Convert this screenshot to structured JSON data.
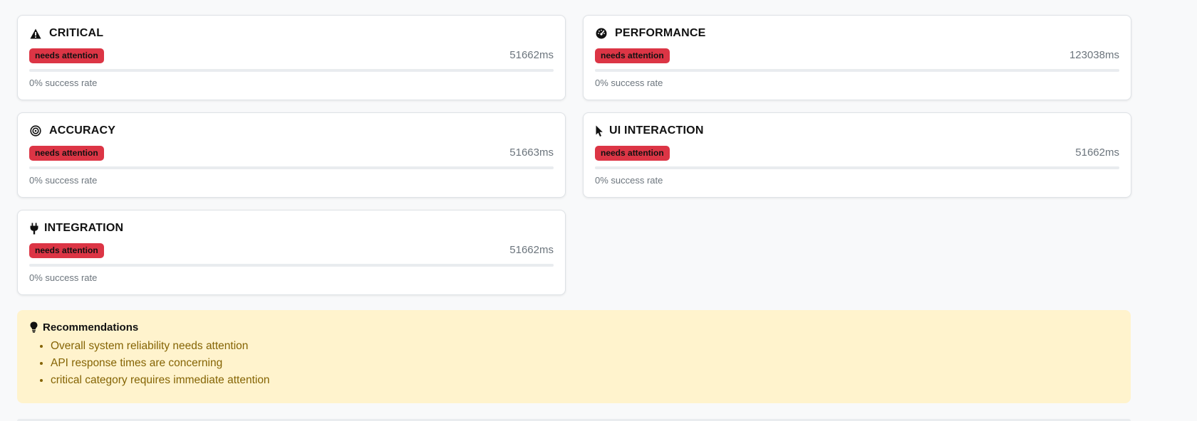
{
  "cards": [
    {
      "title": "CRITICAL",
      "icon": "warning-icon",
      "badge": "needs attention",
      "time": "51662ms",
      "success_fraction": 0,
      "rate": "0% success rate"
    },
    {
      "title": "PERFORMANCE",
      "icon": "gauge-icon",
      "badge": "needs attention",
      "time": "123038ms",
      "success_fraction": 0,
      "rate": "0% success rate"
    },
    {
      "title": "ACCURACY",
      "icon": "target-icon",
      "badge": "needs attention",
      "time": "51663ms",
      "success_fraction": 0,
      "rate": "0% success rate"
    },
    {
      "title": "UI INTERACTION",
      "icon": "cursor-icon",
      "badge": "needs attention",
      "time": "51662ms",
      "success_fraction": 0,
      "rate": "0% success rate"
    },
    {
      "title": "INTEGRATION",
      "icon": "plug-icon",
      "badge": "needs attention",
      "time": "51662ms",
      "success_fraction": 0,
      "rate": "0% success rate"
    }
  ],
  "recommendations": {
    "title": "Recommendations",
    "icon": "lightbulb-icon",
    "items": [
      "Overall system reliability needs attention",
      "API response times are concerning",
      "critical category requires immediate attention"
    ]
  },
  "colors": {
    "danger": "#dc3545",
    "warning_bg": "#fff3cd",
    "warning_text": "#856404",
    "muted": "#6c757d"
  }
}
